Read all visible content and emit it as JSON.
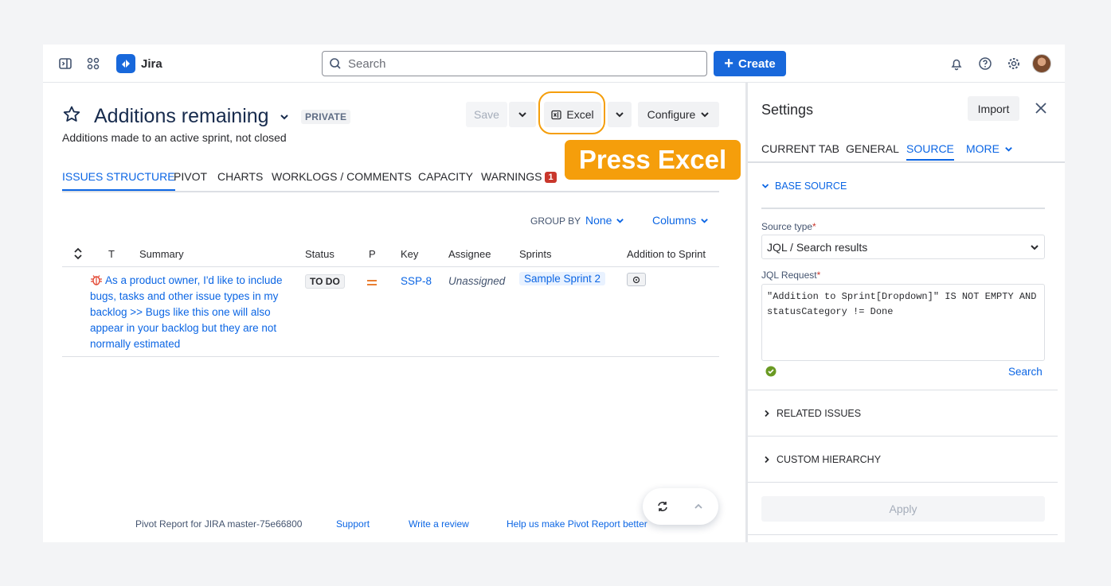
{
  "topbar": {
    "app_name": "Jira",
    "search_placeholder": "Search",
    "create_label": "Create"
  },
  "report": {
    "title": "Additions remaining",
    "privacy": "PRIVATE",
    "subtitle": "Additions made to an active sprint, not closed",
    "save_label": "Save",
    "excel_label": "Excel",
    "configure_label": "Configure",
    "tabs": [
      "ISSUES STRUCTURE",
      "PIVOT",
      "CHARTS",
      "WORKLOGS / COMMENTS",
      "CAPACITY",
      "WARNINGS"
    ],
    "warnings_count": "1",
    "group_by_label": "GROUP BY",
    "group_by_value": "None",
    "columns_label": "Columns"
  },
  "annotation": {
    "text": "Press Excel",
    "color": "#f59e0b"
  },
  "table": {
    "headers": {
      "t": "T",
      "summary": "Summary",
      "status": "Status",
      "priority": "P",
      "key": "Key",
      "assignee": "Assignee",
      "sprints": "Sprints",
      "addition": "Addition to Sprint"
    },
    "rows": [
      {
        "type_icon": "bug-icon",
        "summary": "As a product owner, I'd like to include bugs, tasks and other issue types in my backlog >> Bugs like this one will also appear in your backlog but they are not normally estimated",
        "status": "TO DO",
        "priority_icon": "medium-priority-icon",
        "key": "SSP-8",
        "assignee": "Unassigned",
        "sprint": "Sample Sprint 2"
      }
    ]
  },
  "footer": {
    "version": "Pivot Report for JIRA master-75e66800",
    "support": "Support",
    "review": "Write a review",
    "help": "Help us make Pivot Report better"
  },
  "settings": {
    "title": "Settings",
    "import_label": "Import",
    "tabs": [
      "CURRENT TAB",
      "GENERAL",
      "SOURCE",
      "MORE"
    ],
    "active_tab": "SOURCE",
    "base_source": "BASE SOURCE",
    "source_type_label": "Source type",
    "source_type_value": "JQL / Search results",
    "jql_label": "JQL Request",
    "jql_value": "\"Addition to Sprint[Dropdown]\" IS NOT EMPTY AND statusCategory != Done",
    "search_label": "Search",
    "related_issues": "RELATED ISSUES",
    "custom_hierarchy": "CUSTOM HIERARCHY",
    "apply_label": "Apply"
  },
  "colors": {
    "accent": "#0c66e4",
    "brand": "#1868db",
    "highlight": "#f59e0b",
    "danger": "#c9372c"
  }
}
